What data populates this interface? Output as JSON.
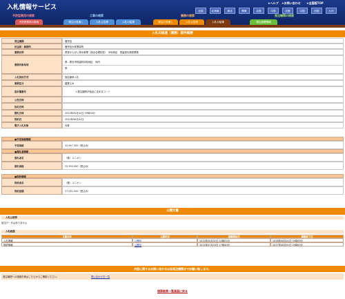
{
  "app": {
    "title": "入札情報サービス"
  },
  "utility": {
    "help": "ヘルプ",
    "contact": "お問い合わせ",
    "nav": "全国版TOP"
  },
  "regions": [
    "北海道",
    "東北",
    "関東",
    "北陸",
    "中部",
    "近畿",
    "中国",
    "四国",
    "九州"
  ],
  "region_all": "全国",
  "sections": {
    "reserved": "予防型費用の検索",
    "construction": "工事の検索",
    "service": "業務の検索",
    "ordering": "発注機関の検索"
  },
  "tabs": {
    "t1": "予防型費用の検索",
    "t2": "発注の見通し",
    "t3": "入札公告等",
    "t4": "入札の結果",
    "t5": "発注の見通し",
    "t6": "入札公告等",
    "t7": "入札の結果",
    "t8": "発注機関情報"
  },
  "page_title": "入札の経過（業務）案件概要",
  "fields": {
    "l1": "発注機関",
    "v1": "鹿児島",
    "l2": "担当部・事務所",
    "v2": "鹿児島大林業部所",
    "l3": "業務名称",
    "v3": "県営かんがい排水事業（保全合理化型）　中地地区　測量設計調査業務",
    "l4": "業務対象地域",
    "v4a": "県：霧島市牧園町持松地区　地内",
    "v4b": "県",
    "l5": "入札契約方式",
    "v5": "指名競争入札",
    "l6": "業務区分",
    "v6": "農業土木",
    "l7": "設計書番号",
    "v7": "＊発注機関が独自に定めるコード",
    "l8": "公告日時",
    "v8": "",
    "l9": "指名日時",
    "v9": "",
    "l10": "開札日時",
    "v10": "2022年05月31日 09時14分",
    "l11": "契約日",
    "v11": "2022年06月02日",
    "l12": "電子入札対象",
    "v12": "対象"
  },
  "sub1": "■予定価格情報",
  "f2": {
    "l1": "予定価格",
    "v1": "32,697,500（税込み）"
  },
  "sub2": "■落札者情報",
  "f3": {
    "l1": "落札者名",
    "v1": "（株）ユニオン",
    "l2": "落札価格",
    "v2": "25,993,000（税込み）"
  },
  "sub3": "■契約情報",
  "f4": {
    "l1": "契約者名",
    "v1": "（株）ユニオン",
    "l2": "契約金額",
    "v2": "27,051,000（税込み）"
  },
  "docs": {
    "title": "公開文書",
    "section1": "入札公告等",
    "note1": "該当データはありません",
    "section2": "入札経過",
    "headers": [
      "文書名称",
      "公開状況",
      "掲載開始日",
      "掲載終了日"
    ],
    "rows": [
      [
        "入札情報",
        "公開中",
        "2022年05月31日 10時51分",
        "2026年06月01日 09時00分"
      ],
      [
        "契約情報",
        "公開中",
        "2022年07月25日 17時40分",
        "2027年06月01日 09時00分"
      ]
    ]
  },
  "inquiry": {
    "title": "内容に関するお問い合わせは各発注機関までお願い致します。",
    "text": "発注機関への連絡先等はこちらからご確認ください。",
    "link": "問い合わせ先一覧"
  },
  "back": "検索結果一覧画面に戻る",
  "colors": {
    "header": "#1c3a8c",
    "accent": "#ef8a00",
    "label_bg": "#fde2c8"
  }
}
